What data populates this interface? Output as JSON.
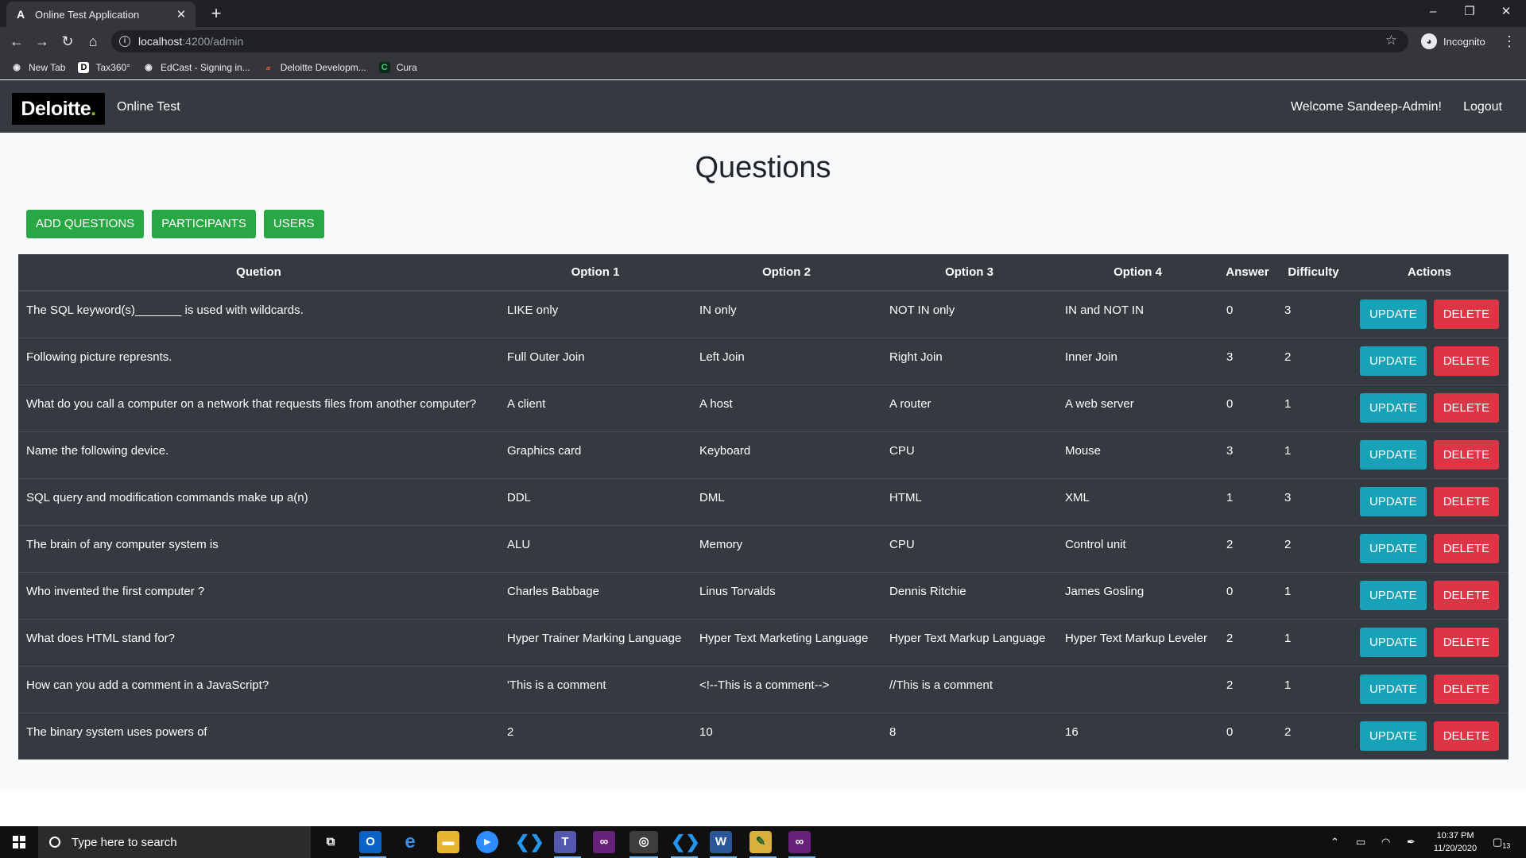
{
  "browser": {
    "tab_title": "Online Test Application",
    "tab_favicon": "A",
    "url_host": "localhost",
    "url_path": ":4200/admin",
    "incognito_label": "Incognito",
    "bookmarks": [
      {
        "label": "New Tab",
        "icon": "globe-icon"
      },
      {
        "label": "Tax360°",
        "icon": "d-icon"
      },
      {
        "label": "EdCast - Signing in...",
        "icon": "globe-icon"
      },
      {
        "label": "Deloitte Developm...",
        "icon": "deloitte-icon"
      },
      {
        "label": "Cura",
        "icon": "c-icon"
      }
    ]
  },
  "app": {
    "logo": "Deloitte",
    "logo_dot": ".",
    "brand": "Online Test",
    "welcome": "Welcome Sandeep-Admin!",
    "logout": "Logout",
    "title": "Questions",
    "actions": [
      "ADD QUESTIONS",
      "PARTICIPANTS",
      "USERS"
    ]
  },
  "table": {
    "headers": [
      "Quetion",
      "Option 1",
      "Option 2",
      "Option 3",
      "Option 4",
      "Answer",
      "Difficulty",
      "Actions"
    ],
    "update_label": "UPDATE",
    "delete_label": "DELETE",
    "rows": [
      {
        "q": "The SQL keyword(s)_______ is used with wildcards.",
        "o1": "LIKE only",
        "o2": "IN only",
        "o3": "NOT IN only",
        "o4": "IN and NOT IN",
        "a": "0",
        "d": "3"
      },
      {
        "q": "Following picture represnts.",
        "o1": "Full Outer Join",
        "o2": "Left Join",
        "o3": "Right Join",
        "o4": "Inner Join",
        "a": "3",
        "d": "2"
      },
      {
        "q": "What do you call a computer on a network that requests files from another computer?",
        "o1": "A client",
        "o2": "A host",
        "o3": "A router",
        "o4": "A web server",
        "a": "0",
        "d": "1"
      },
      {
        "q": "Name the following device.",
        "o1": "Graphics card",
        "o2": "Keyboard",
        "o3": "CPU",
        "o4": "Mouse",
        "a": "3",
        "d": "1"
      },
      {
        "q": "SQL query and modification commands make up a(n)",
        "o1": "DDL",
        "o2": "DML",
        "o3": "HTML",
        "o4": "XML",
        "a": "1",
        "d": "3"
      },
      {
        "q": "The brain of any computer system is",
        "o1": "ALU",
        "o2": "Memory",
        "o3": "CPU",
        "o4": "Control unit",
        "a": "2",
        "d": "2"
      },
      {
        "q": "Who invented the first computer ?",
        "o1": "Charles Babbage",
        "o2": "Linus Torvalds",
        "o3": "Dennis Ritchie",
        "o4": "James Gosling",
        "a": "0",
        "d": "1"
      },
      {
        "q": "What does HTML stand for?",
        "o1": "Hyper Trainer Marking Language",
        "o2": "Hyper Text Marketing Language",
        "o3": "Hyper Text Markup Language",
        "o4": "Hyper Text Markup Leveler",
        "a": "2",
        "d": "1"
      },
      {
        "q": "How can you add a comment in a JavaScript?",
        "o1": "'This is a comment",
        "o2": "<!--This is a comment-->",
        "o3": "//This is a comment",
        "o4": "",
        "a": "2",
        "d": "1"
      },
      {
        "q": "The binary system uses powers of",
        "o1": "2",
        "o2": "10",
        "o3": "8",
        "o4": "16",
        "a": "0",
        "d": "2"
      }
    ]
  },
  "taskbar": {
    "search_placeholder": "Type here to search",
    "time": "10:37 PM",
    "date": "11/20/2020",
    "notification_count": "13"
  }
}
